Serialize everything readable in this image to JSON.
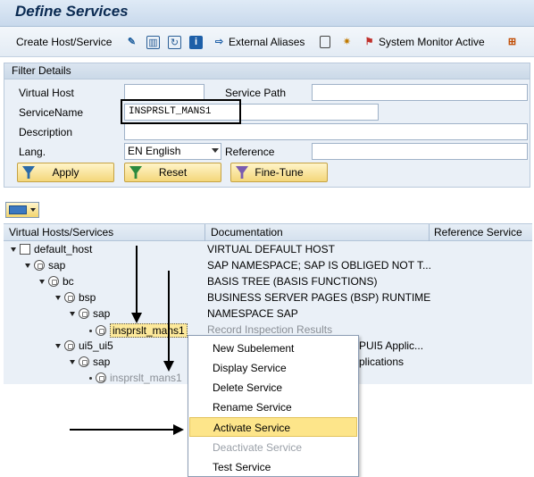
{
  "title": "Define Services",
  "toolbar": {
    "create_host": "Create Host/Service",
    "external_aliases": "External Aliases",
    "system_monitor": "System Monitor Active"
  },
  "filter": {
    "header": "Filter Details",
    "virtual_host_label": "Virtual Host",
    "virtual_host_value": "",
    "service_path_label": "Service Path",
    "service_path_value": "",
    "service_name_label": "ServiceName",
    "service_name_value": "INSPRSLT_MANS1",
    "description_label": "Description",
    "description_value": "",
    "lang_label": "Lang.",
    "lang_value": "EN English",
    "reference_label": "Reference",
    "reference_value": "",
    "apply": "Apply",
    "reset": "Reset",
    "fine_tune": "Fine-Tune"
  },
  "tree": {
    "columns": [
      "Virtual Hosts/Services",
      "Documentation",
      "Reference Service"
    ],
    "rows": [
      {
        "name": "default_host",
        "doc": "VIRTUAL DEFAULT HOST"
      },
      {
        "name": "sap",
        "doc": "SAP NAMESPACE; SAP IS OBLIGED NOT T..."
      },
      {
        "name": "bc",
        "doc": "BASIS TREE (BASIS FUNCTIONS)"
      },
      {
        "name": "bsp",
        "doc": "BUSINESS SERVER PAGES (BSP) RUNTIME"
      },
      {
        "name": "sap",
        "doc": "NAMESPACE SAP"
      },
      {
        "name": "insprslt_mans1",
        "doc": "Record Inspection Results"
      },
      {
        "name": "ui5_ui5",
        "doc": "PUI5 Applic..."
      },
      {
        "name": "sap",
        "doc": "plications"
      },
      {
        "name": "insprslt_mans1",
        "doc": ""
      }
    ]
  },
  "context_menu": [
    {
      "label": "New Subelement",
      "state": "normal"
    },
    {
      "label": "Display Service",
      "state": "normal"
    },
    {
      "label": "Delete Service",
      "state": "normal"
    },
    {
      "label": "Rename Service",
      "state": "normal"
    },
    {
      "label": "Activate Service",
      "state": "highlighted"
    },
    {
      "label": "Deactivate Service",
      "state": "disabled"
    },
    {
      "label": "Test Service",
      "state": "normal"
    }
  ],
  "colors": {
    "highlight": "#fde58a",
    "button": "#f4d77a",
    "panel": "#eaf0f7",
    "title": "#0a2a52"
  }
}
